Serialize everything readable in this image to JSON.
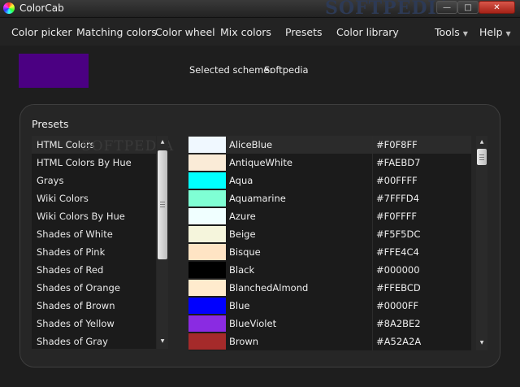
{
  "window": {
    "title": "ColorCab",
    "watermark": "SOFTPEDIA",
    "minimize": "—",
    "maximize": "□",
    "close": "✕"
  },
  "menu": {
    "items": [
      "Color picker",
      "Matching colors",
      "Color wheel",
      "Mix colors",
      "Presets",
      "Color library"
    ],
    "tools": "Tools",
    "help": "Help"
  },
  "scheme": {
    "color": "#4B0082",
    "label": "Selected scheme:",
    "value": "Softpedia"
  },
  "presets": {
    "title": "Presets",
    "items": [
      "HTML Colors",
      "HTML Colors By Hue",
      "Grays",
      "Wiki Colors",
      "Wiki Colors By Hue",
      "Shades of White",
      "Shades of Pink",
      "Shades of Red",
      "Shades of Orange",
      "Shades of Brown",
      "Shades of Yellow",
      "Shades of Gray"
    ],
    "selected_index": 0
  },
  "colors": {
    "rows": [
      {
        "name": "AliceBlue",
        "hex": "#F0F8FF",
        "swatch": "#F0F8FF"
      },
      {
        "name": "AntiqueWhite",
        "hex": "#FAEBD7",
        "swatch": "#FAEBD7"
      },
      {
        "name": "Aqua",
        "hex": "#00FFFF",
        "swatch": "#00FFFF"
      },
      {
        "name": "Aquamarine",
        "hex": "#7FFFD4",
        "swatch": "#7FFFD4"
      },
      {
        "name": "Azure",
        "hex": "#F0FFFF",
        "swatch": "#F0FFFF"
      },
      {
        "name": "Beige",
        "hex": "#F5F5DC",
        "swatch": "#F5F5DC"
      },
      {
        "name": "Bisque",
        "hex": "#FFE4C4",
        "swatch": "#FFE4C4"
      },
      {
        "name": "Black",
        "hex": "#000000",
        "swatch": "#000000"
      },
      {
        "name": "BlanchedAlmond",
        "hex": "#FFEBCD",
        "swatch": "#FFEBCD"
      },
      {
        "name": "Blue",
        "hex": "#0000FF",
        "swatch": "#0000FF"
      },
      {
        "name": "BlueViolet",
        "hex": "#8A2BE2",
        "swatch": "#8A2BE2"
      },
      {
        "name": "Brown",
        "hex": "#A52A2A",
        "swatch": "#A52A2A"
      }
    ],
    "selected_index": 0
  },
  "icons": {
    "scroll_up": "up-arrow-icon",
    "scroll_down": "down-arrow-icon",
    "dropdown": "chevron-down-icon"
  }
}
